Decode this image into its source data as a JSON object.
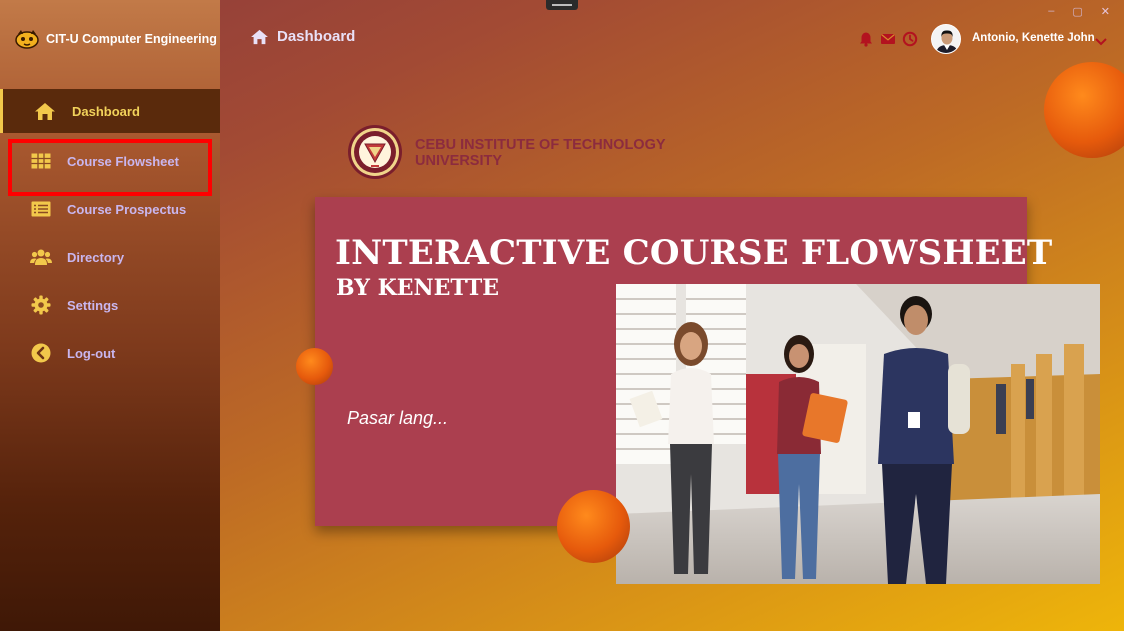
{
  "app": {
    "title": "CIT-U Computer Engineering",
    "window_controls": {
      "minimize": "–",
      "maximize": "▢",
      "close": "✕"
    }
  },
  "sidebar": {
    "items": [
      {
        "label": "Dashboard",
        "icon": "home-icon",
        "active": true
      },
      {
        "label": "Course Flowsheet",
        "icon": "table-icon",
        "active": false,
        "highlighted": true
      },
      {
        "label": "Course Prospectus",
        "icon": "list-icon",
        "active": false
      },
      {
        "label": "Directory",
        "icon": "users-icon",
        "active": false
      },
      {
        "label": "Settings",
        "icon": "gear-icon",
        "active": false
      },
      {
        "label": "Log-out",
        "icon": "chevron-left-circle-icon",
        "active": false
      }
    ]
  },
  "header": {
    "page_title": "Dashboard",
    "icons": [
      "bell-icon",
      "envelope-icon",
      "clock-icon"
    ],
    "user_name": "Antonio, Kenette John"
  },
  "main": {
    "university_name_line1": "CEBU INSTITUTE OF TECHNOLOGY",
    "university_name_line2": "UNIVERSITY",
    "hero_title": "INTERACTIVE COURSE FLOWSHEET",
    "hero_subtitle": "BY KENETTE",
    "tagline": "Pasar lang..."
  },
  "colors": {
    "accent_gold": "#f2c84b",
    "card_red": "#ab3f4f",
    "nav_text": "#c9b6ee",
    "highlight_red": "#ff0000",
    "header_icon": "#b3121f"
  }
}
